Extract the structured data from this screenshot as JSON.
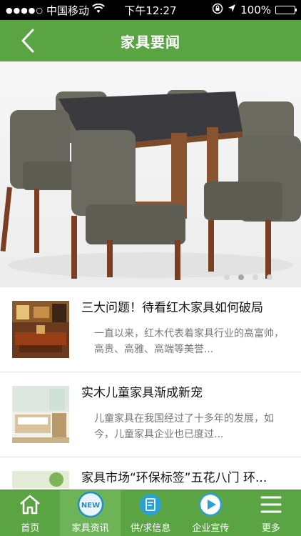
{
  "status_bar": {
    "signal_dots": "●●●●○",
    "carrier": "中国移动",
    "time": "下午12:27",
    "battery": "100%"
  },
  "nav": {
    "title": "家具要闻"
  },
  "banner": {
    "page_count": 4,
    "active_page": 2
  },
  "news": [
    {
      "title": "三大问题！待看红木家具如何破局",
      "summary": "一直以来，红木代表着家具行业的高富帅，高贵、高雅、高端等美誉..."
    },
    {
      "title": "实木儿童家具渐成新宠",
      "summary": "儿童家具在我国经过了十多年的发展，如今，儿童家具企业也已度过..."
    },
    {
      "title": "家具市场“环保标签”五花八门 环...",
      "summary": ""
    }
  ],
  "tabs": [
    {
      "label": "首页",
      "icon": "home-icon"
    },
    {
      "label": "家具资讯",
      "icon": "new-badge-icon",
      "badge": "NEW"
    },
    {
      "label": "供/求信息",
      "icon": "supply-icon"
    },
    {
      "label": "企业宣传",
      "icon": "play-icon"
    },
    {
      "label": "更多",
      "icon": "menu-icon"
    }
  ],
  "colors": {
    "brand_green": "#5aa444",
    "active_tab": "#6db458"
  }
}
